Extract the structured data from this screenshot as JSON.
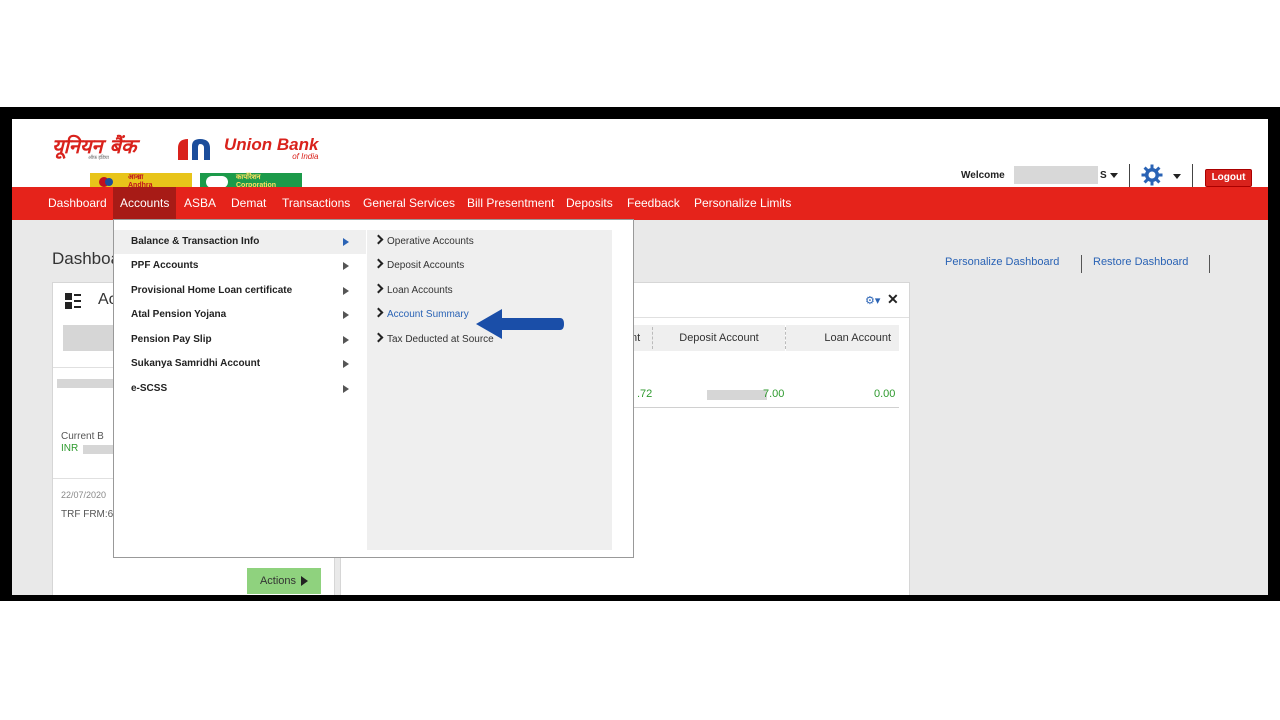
{
  "header": {
    "logo_hindi": "यूनियन बैंक",
    "logo_hindi_sub": "ऑफ़ इंडिया",
    "logo_english": "Union Bank",
    "logo_english_sub": "of India",
    "partner1": "Andhra",
    "partner1_hindi": "आन्ध्रा",
    "partner2": "Corporation",
    "partner2_hindi": "कार्पोरेशन",
    "welcome_label": "Welcome",
    "user_suffix": "S",
    "logout_label": "Logout",
    "settings_icon": "gear-icon",
    "brand_color": "#d9221c"
  },
  "nav": {
    "items": [
      {
        "label": "Dashboard"
      },
      {
        "label": "Accounts"
      },
      {
        "label": "ASBA"
      },
      {
        "label": "Demat"
      },
      {
        "label": "Transactions"
      },
      {
        "label": "General Services"
      },
      {
        "label": "Bill Presentment"
      },
      {
        "label": "Deposits"
      },
      {
        "label": "Feedback"
      },
      {
        "label": "Personalize Limits"
      }
    ],
    "active": "Accounts",
    "bar_color": "#e5231b",
    "active_color": "#a71b16"
  },
  "page": {
    "title_partial": "Dashboa",
    "personalize_link": "Personalize Dashboard",
    "restore_link": "Restore Dashboard"
  },
  "left_panel": {
    "title_partial": "Ac",
    "current_balance_partial": "Current B",
    "currency": "INR",
    "date_partial": "22/07/2020",
    "trf_partial": "TRF FRM:6",
    "actions_label": "Actions"
  },
  "right_panel": {
    "headers": [
      "nt",
      "Deposit Account",
      "Loan Account"
    ],
    "values": [
      ".72",
      "7.00",
      "0.00"
    ]
  },
  "dropdown": {
    "left_items": [
      {
        "label": "Balance & Transaction Info"
      },
      {
        "label": "PPF Accounts"
      },
      {
        "label": "Provisional Home Loan certificate"
      },
      {
        "label": "Atal Pension Yojana"
      },
      {
        "label": "Pension Pay Slip"
      },
      {
        "label": "Sukanya Samridhi Account"
      },
      {
        "label": "e-SCSS"
      }
    ],
    "selected": "Balance & Transaction Info",
    "sub_items": [
      {
        "label": "Operative Accounts"
      },
      {
        "label": "Deposit Accounts"
      },
      {
        "label": "Loan Accounts"
      },
      {
        "label": "Account Summary"
      },
      {
        "label": "Tax Deducted at Source"
      }
    ],
    "highlighted_sub": "Account Summary"
  }
}
